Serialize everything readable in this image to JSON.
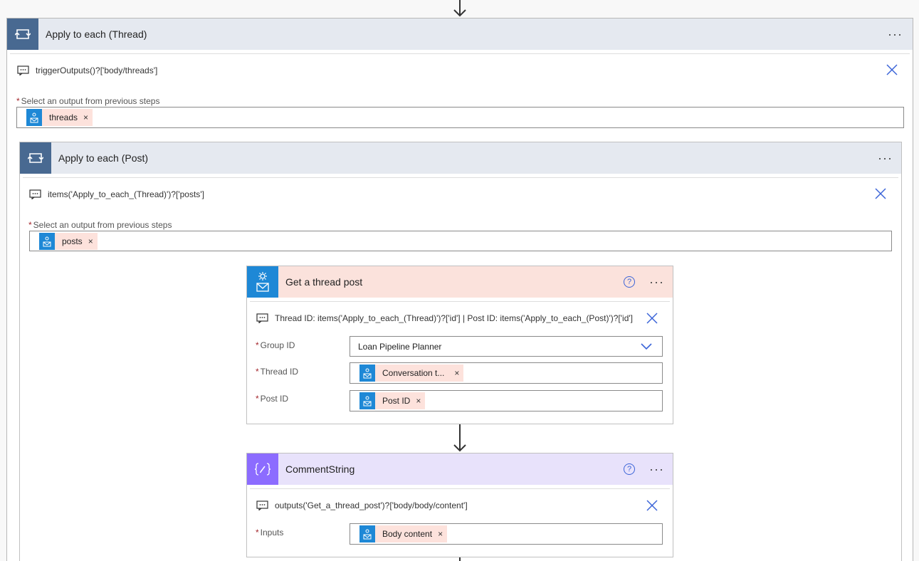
{
  "colors": {
    "loop_header": "#e5e9f0",
    "loop_icon_bg": "#486991",
    "groups_header": "#fbe2dc",
    "groups_icon_bg": "#1e88d6",
    "compose_header": "#e8e2fb",
    "compose_icon_bg": "#8c6cff",
    "token_bg": "#fde2dc"
  },
  "outer_loop": {
    "title": "Apply to each (Thread)",
    "menu": "···",
    "note": "triggerOutputs()?['body/threads']",
    "field_label": "Select an output from previous steps",
    "required_mark": "*",
    "token": {
      "icon": "office-groups-icon",
      "label": "threads",
      "remove": "×"
    }
  },
  "inner_loop": {
    "title": "Apply to each (Post)",
    "menu": "···",
    "note": "items('Apply_to_each_(Thread)')?['posts']",
    "field_label": "Select an output from previous steps",
    "required_mark": "*",
    "token": {
      "icon": "office-groups-icon",
      "label": "posts",
      "remove": "×"
    }
  },
  "get_post": {
    "title": "Get a thread post",
    "help": "?",
    "menu": "···",
    "note": "Thread ID: items('Apply_to_each_(Thread)')?['id'] | Post ID: items('Apply_to_each_(Post)')?['id']",
    "fields": [
      {
        "label": "Group ID",
        "required_mark": "*",
        "value": "Loan Pipeline Planner"
      },
      {
        "label": "Thread ID",
        "required_mark": "*",
        "token": "Conversation t...",
        "remove": "×"
      },
      {
        "label": "Post ID",
        "required_mark": "*",
        "token": "Post ID",
        "remove": "×"
      }
    ]
  },
  "compose": {
    "title": "CommentString",
    "help": "?",
    "menu": "···",
    "note": "outputs('Get_a_thread_post')?['body/body/content']",
    "fields": [
      {
        "label": "Inputs",
        "required_mark": "*",
        "token": "Body content",
        "remove": "×"
      }
    ]
  }
}
